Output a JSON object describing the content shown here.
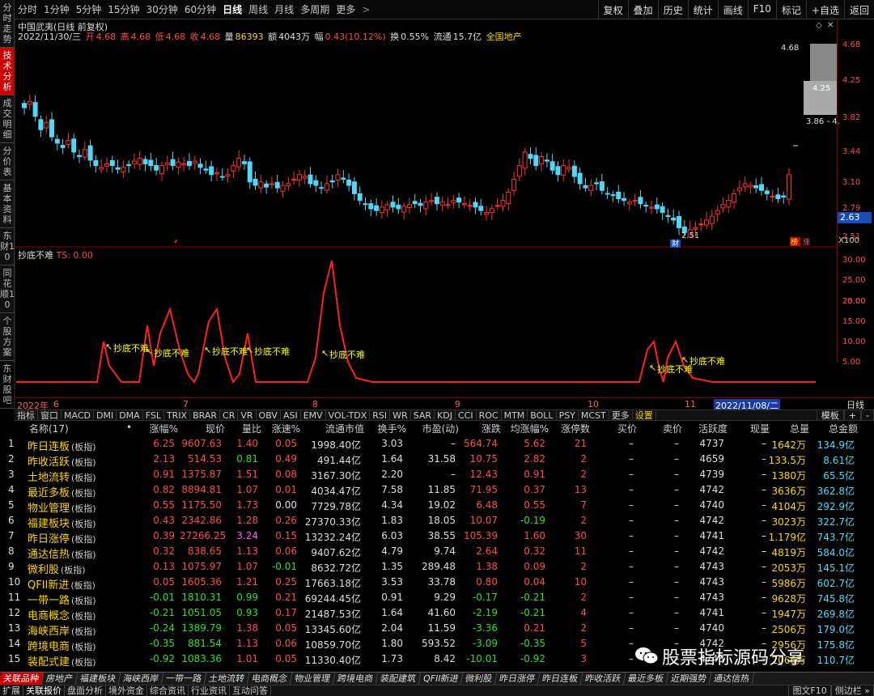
{
  "periods": [
    "分时",
    "1分钟",
    "5分钟",
    "15分钟",
    "30分钟",
    "60分钟",
    "日线",
    "周线",
    "月线",
    "多周期",
    "更多"
  ],
  "periods_more_mark": ">",
  "toolbar_right": [
    "复权",
    "叠加",
    "历史",
    "统计",
    "画线",
    "F10",
    "标记",
    "+自选",
    "返回"
  ],
  "left_tabs": [
    "分时走势",
    "技术分析",
    "成交明细",
    "分价表",
    "基本资料",
    "东财10",
    "同花顺10",
    "个股方案",
    "东财股吧"
  ],
  "stock_title": "中国武夷(日线 前复权)",
  "info": {
    "date": "2022/11/30/三",
    "open_label": "开",
    "open": "4.68",
    "high_label": "高",
    "high": "4.68",
    "low_label": "低",
    "low": "4.68",
    "close_label": "收",
    "close": "4.68",
    "vol_label": "量",
    "vol": "86393",
    "amt_label": "额",
    "amt": "4043万",
    "chg_label": "幅",
    "chg": "0.43(10.12%)",
    "turn_label": "换",
    "turn": "0.55%",
    "float_label": "流通",
    "float": "15.7亿",
    "sector": "全国地产"
  },
  "main_yaxis": [
    "4.68",
    "4.25",
    "3.82",
    "3.44",
    "3.10",
    "2.79",
    "2.51"
  ],
  "current_price": "2.63",
  "x100": "X100",
  "hl_labels": {
    "top": "4.68",
    "mid": "4.25",
    "bottom": "3.86 - 4.",
    "low": "2.51"
  },
  "markers": {
    "cai": "财",
    "jia": "榜",
    "zhang": "涨"
  },
  "indicator": {
    "name": "抄底不难",
    "value": "TS: 0.00",
    "signal": "抄底不难"
  },
  "indicator_yaxis": [
    "30.00",
    "25.00",
    "20.00",
    "15.00",
    "10.00",
    "5.00"
  ],
  "date_axis": {
    "year": "2022年",
    "m6": "6",
    "m7": "7",
    "m8": "8",
    "m9": "9",
    "m10": "10",
    "m11": "11",
    "selected": "2022/11/08/二",
    "right": "日线"
  },
  "ind_tabs": [
    "指标",
    "窗口",
    "MACD",
    "DMI",
    "DMA",
    "FSL",
    "TRIX",
    "BRAR",
    "CR",
    "VR",
    "OBV",
    "ASI",
    "EMV",
    "VOL-TDX",
    "RSI",
    "WR",
    "SAR",
    "KDJ",
    "CCI",
    "ROC",
    "MTM",
    "BOLL",
    "PSY",
    "MCST",
    "更多",
    "设置"
  ],
  "ind_tabs_right": [
    "模板",
    "+",
    "-"
  ],
  "columns": [
    "名称(17)",
    "涨幅%",
    "现价",
    "量比",
    "涨速%",
    "流通市值",
    "换手%",
    "市盈(动)",
    "涨跌",
    "均涨幅%",
    "涨停数",
    "买价",
    "卖价",
    "活跃度",
    "现量",
    "总量",
    "总金额"
  ],
  "rows": [
    {
      "i": "1",
      "name": "昨日连板",
      "tag": "(板指)",
      "chg": "6.25",
      "price": "9607.63",
      "vr": "1.40",
      "spd": "0.05",
      "cap": "1998.40亿",
      "turn": "3.03",
      "pe": "–",
      "diff": "564.74",
      "avg": "5.62",
      "lim": "21",
      "bid": "–",
      "ask": "–",
      "act": "4737",
      "cur": "–",
      "vol": "1642万",
      "amt": "134.9亿"
    },
    {
      "i": "2",
      "name": "昨收活跃",
      "tag": "(板指)",
      "chg": "2.13",
      "price": "514.53",
      "vr": "0.81",
      "spd": "0.49",
      "cap": "491.44亿",
      "turn": "1.64",
      "pe": "31.58",
      "diff": "10.75",
      "avg": "2.82",
      "lim": "2",
      "bid": "–",
      "ask": "–",
      "act": "4659",
      "cur": "–",
      "vol": "133.5万",
      "amt": "8.61亿"
    },
    {
      "i": "3",
      "name": "土地流转",
      "tag": "(板指)",
      "chg": "0.91",
      "price": "1375.87",
      "vr": "1.51",
      "spd": "0.08",
      "cap": "3167.30亿",
      "turn": "2.20",
      "pe": "–",
      "diff": "12.43",
      "avg": "0.91",
      "lim": "2",
      "bid": "–",
      "ask": "–",
      "act": "4739",
      "cur": "–",
      "vol": "1380万",
      "amt": "65.5亿"
    },
    {
      "i": "4",
      "name": "最近多板",
      "tag": "(板指)",
      "chg": "0.82",
      "price": "8894.81",
      "vr": "1.07",
      "spd": "0.01",
      "cap": "4034.47亿",
      "turn": "7.58",
      "pe": "11.85",
      "diff": "71.95",
      "avg": "0.37",
      "lim": "13",
      "bid": "–",
      "ask": "–",
      "act": "4742",
      "cur": "–",
      "vol": "3636万",
      "amt": "362.8亿"
    },
    {
      "i": "5",
      "name": "物业管理",
      "tag": "(板指)",
      "chg": "0.55",
      "price": "1175.50",
      "vr": "1.73",
      "spd": "0.00",
      "cap": "7729.78亿",
      "turn": "4.34",
      "pe": "19.02",
      "diff": "6.48",
      "avg": "0.55",
      "lim": "7",
      "bid": "–",
      "ask": "–",
      "act": "4740",
      "cur": "–",
      "vol": "4104万",
      "amt": "292.9亿"
    },
    {
      "i": "6",
      "name": "福建板块",
      "tag": "(板指)",
      "chg": "0.43",
      "price": "2342.86",
      "vr": "1.28",
      "spd": "0.26",
      "cap": "27370.33亿",
      "turn": "1.83",
      "pe": "18.05",
      "diff": "10.07",
      "avg": "-0.19",
      "lim": "2",
      "bid": "–",
      "ask": "–",
      "act": "4742",
      "cur": "–",
      "vol": "3023万",
      "amt": "322.7亿"
    },
    {
      "i": "7",
      "name": "昨日涨停",
      "tag": "(板指)",
      "chg": "0.39",
      "price": "27266.25",
      "vr": "3.24",
      "spd": "0.15",
      "cap": "13232.24亿",
      "turn": "6.03",
      "pe": "38.55",
      "diff": "105.39",
      "avg": "1.60",
      "lim": "30",
      "bid": "–",
      "ask": "–",
      "act": "4741",
      "cur": "–",
      "vol": "1.179亿",
      "amt": "743.7亿"
    },
    {
      "i": "8",
      "name": "通达信热",
      "tag": "(板指)",
      "chg": "0.32",
      "price": "838.65",
      "vr": "1.13",
      "spd": "0.06",
      "cap": "9407.62亿",
      "turn": "4.79",
      "pe": "9.74",
      "diff": "2.64",
      "avg": "0.32",
      "lim": "11",
      "bid": "–",
      "ask": "–",
      "act": "4742",
      "cur": "–",
      "vol": "4819万",
      "amt": "584.0亿"
    },
    {
      "i": "9",
      "name": "微利股",
      "tag": "(板指)",
      "chg": "0.13",
      "price": "1075.97",
      "vr": "1.07",
      "spd": "-0.01",
      "cap": "8632.72亿",
      "turn": "1.35",
      "pe": "289.48",
      "diff": "1.38",
      "avg": "0.09",
      "lim": "2",
      "bid": "–",
      "ask": "–",
      "act": "4743",
      "cur": "–",
      "vol": "2053万",
      "amt": "145.1亿"
    },
    {
      "i": "10",
      "name": "QFII新进",
      "tag": "(板指)",
      "chg": "0.05",
      "price": "1605.36",
      "vr": "1.21",
      "spd": "0.25",
      "cap": "17663.18亿",
      "turn": "3.53",
      "pe": "33.78",
      "diff": "0.80",
      "avg": "0.04",
      "lim": "10",
      "bid": "–",
      "ask": "–",
      "act": "4743",
      "cur": "–",
      "vol": "5986万",
      "amt": "602.7亿"
    },
    {
      "i": "11",
      "name": "一带一路",
      "tag": "(板指)",
      "chg": "-0.01",
      "price": "1810.31",
      "vr": "0.99",
      "spd": "0.21",
      "cap": "69244.45亿",
      "turn": "0.91",
      "pe": "9.29",
      "diff": "-0.17",
      "avg": "-0.21",
      "lim": "2",
      "bid": "–",
      "ask": "–",
      "act": "4743",
      "cur": "–",
      "vol": "9628万",
      "amt": "745.8亿"
    },
    {
      "i": "12",
      "name": "电商概念",
      "tag": "(板指)",
      "chg": "-0.21",
      "price": "1051.05",
      "vr": "0.93",
      "spd": "0.17",
      "cap": "21487.53亿",
      "turn": "1.64",
      "pe": "41.60",
      "diff": "-2.19",
      "avg": "-0.21",
      "lim": "4",
      "bid": "–",
      "ask": "–",
      "act": "4741",
      "cur": "–",
      "vol": "1947万",
      "amt": "269.8亿"
    },
    {
      "i": "13",
      "name": "海峡西岸",
      "tag": "(板指)",
      "chg": "-0.24",
      "price": "1389.79",
      "vr": "1.38",
      "spd": "0.05",
      "cap": "13345.60亿",
      "turn": "2.04",
      "pe": "11.59",
      "diff": "-3.36",
      "avg": "0.21",
      "lim": "2",
      "bid": "–",
      "ask": "–",
      "act": "4740",
      "cur": "–",
      "vol": "2506万",
      "amt": "179.0亿"
    },
    {
      "i": "14",
      "name": "跨境电商",
      "tag": "(板指)",
      "chg": "-0.35",
      "price": "881.54",
      "vr": "1.13",
      "spd": "0.06",
      "cap": "10859.70亿",
      "turn": "1.80",
      "pe": "593.52",
      "diff": "-3.09",
      "avg": "-0.35",
      "lim": "5",
      "bid": "–",
      "ask": "–",
      "act": "4742",
      "cur": "–",
      "vol": "2956万",
      "amt": "175.8亿"
    },
    {
      "i": "15",
      "name": "装配式建",
      "tag": "(板指)",
      "chg": "-0.92",
      "price": "1083.36",
      "vr": "1.01",
      "spd": "0.05",
      "cap": "11330.40亿",
      "turn": "1.73",
      "pe": "8.42",
      "diff": "-10.01",
      "avg": "-0.92",
      "lim": "3",
      "bid": "–",
      "ask": "–",
      "act": "4743",
      "cur": "–",
      "vol": "2066万",
      "amt": "110.7亿"
    }
  ],
  "watermark": "股票指标源码分享",
  "bottom_tabs": [
    "关联品种",
    "房地产",
    "福建板块",
    "海峡西岸",
    "一带一路",
    "土地流转",
    "电商概念",
    "物业管理",
    "跨境电商",
    "装配建筑",
    "QFII新进",
    "微利股",
    "昨日涨停",
    "昨日连板",
    "昨收活跃",
    "最近多板",
    "近期强势",
    "通达信热"
  ],
  "bottom_tabs2": [
    "扩展",
    "关联报价",
    "盘面分析",
    "境外资金",
    "综合资讯",
    "行业资讯",
    "互动问答"
  ],
  "bottom_tabs2_right": [
    "图文F10",
    "侧边栏 »"
  ],
  "colors": {
    "up": "#ff4b4b",
    "down": "#2ce02c",
    "cyan": "#4fd8f8",
    "yellow": "#ffd700",
    "indicator": "#ff2020"
  }
}
